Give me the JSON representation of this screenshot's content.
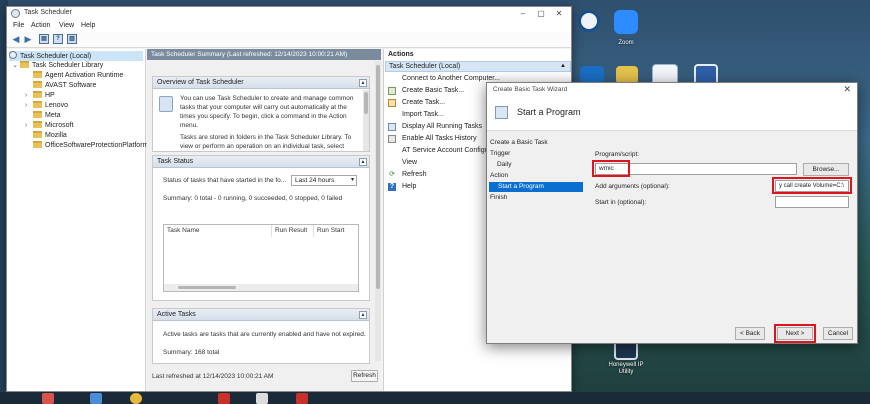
{
  "window": {
    "title": "Task Scheduler",
    "menu": [
      "File",
      "Action",
      "View",
      "Help"
    ]
  },
  "tree": {
    "root": "Task Scheduler (Local)",
    "library": "Task Scheduler Library",
    "folders": [
      "Agent Activation Runtime",
      "AVAST Software",
      "HP",
      "Lenovo",
      "Meta",
      "Microsoft",
      "Mozilla",
      "OfficeSoftwareProtectionPlatform"
    ]
  },
  "center": {
    "header": "Task Scheduler Summary (Last refreshed: 12/14/2023 10:00:21 AM)",
    "overview_title": "Overview of Task Scheduler",
    "overview_text1": "You can use Task Scheduler to create and manage common tasks that your computer will carry out automatically at the times you specify. To begin, click a command in the Action menu.",
    "overview_text2": "Tasks are stored in folders in the Task Scheduler Library. To view or perform an operation on an individual task, select",
    "status_title": "Task Status",
    "status_label": "Status of tasks that have started in the fo...",
    "status_select": "Last 24 hours",
    "summary": "Summary: 0 total - 0 running, 0 succeeded, 0 stopped, 0 failed",
    "table_headers": [
      "Task Name",
      "Run Result",
      "Run Start"
    ],
    "active_title": "Active Tasks",
    "active_text": "Active tasks are tasks that are currently enabled and have not expired.",
    "active_summary": "Summary: 168 total",
    "last_refreshed": "Last refreshed at 12/14/2023 10:00:21 AM",
    "refresh_button": "Refresh"
  },
  "actions": {
    "title": "Actions",
    "section": "Task Scheduler (Local)",
    "items": [
      {
        "label": "Connect to Another Computer...",
        "icon": "none"
      },
      {
        "label": "Create Basic Task...",
        "icon": "wizard-icon"
      },
      {
        "label": "Create Task...",
        "icon": "task-icon"
      },
      {
        "label": "Import Task...",
        "icon": "none"
      },
      {
        "label": "Display All Running Tasks",
        "icon": "list-icon"
      },
      {
        "label": "Enable All Tasks History",
        "icon": "history-icon"
      },
      {
        "label": "AT Service Account Configuration",
        "icon": "none"
      },
      {
        "label": "View",
        "icon": "none"
      },
      {
        "label": "Refresh",
        "icon": "refresh-icon"
      },
      {
        "label": "Help",
        "icon": "help-icon"
      }
    ]
  },
  "wizard": {
    "title": "Create Basic Task Wizard",
    "heading": "Start a Program",
    "nav": [
      "Create a Basic Task",
      "Trigger",
      "Daily",
      "Action",
      "Start a Program",
      "Finish"
    ],
    "program_label": "Program/script:",
    "program_value": "wmic",
    "browse_button": "Browse...",
    "args_label": "Add arguments (optional):",
    "args_value": "y call create Volume=C:\\",
    "startin_label": "Start in (optional):",
    "back_button": "< Back",
    "next_button": "Next >",
    "cancel_button": "Cancel"
  },
  "desktop": {
    "labels": [
      "Zoom",
      "Honeywell IP Utility"
    ]
  },
  "colors": {
    "highlight": "#e0141c",
    "selection": "#0a6fcf"
  }
}
